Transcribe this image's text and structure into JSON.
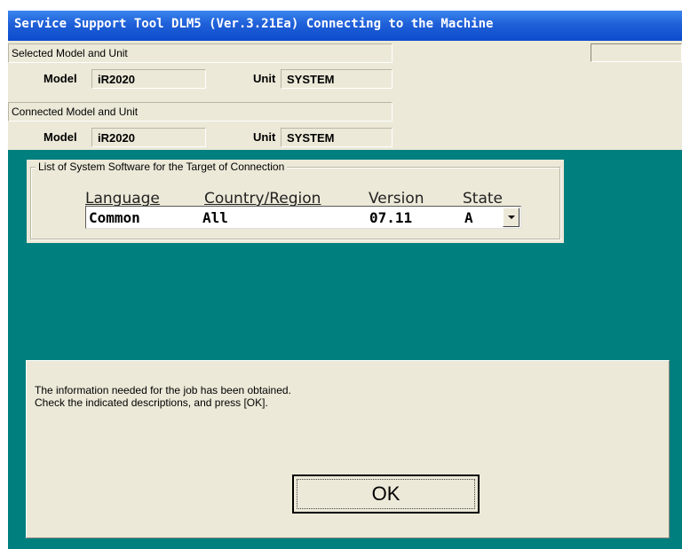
{
  "window": {
    "title": "Service Support Tool DLM5 (Ver.3.21Ea) Connecting to the Machine"
  },
  "selected": {
    "section_label": "Selected Model and Unit",
    "model_label": "Model",
    "model_value": "iR2020",
    "unit_label": "Unit",
    "unit_value": "SYSTEM"
  },
  "connected": {
    "section_label": "Connected Model and Unit",
    "model_label": "Model",
    "model_value": "iR2020",
    "unit_label": "Unit",
    "unit_value": "SYSTEM"
  },
  "software_list": {
    "group_title": "List of System Software for the Target of Connection",
    "columns": {
      "language": "Language",
      "country": "Country/Region",
      "version": "Version",
      "state": "State"
    },
    "row": {
      "language": "Common",
      "country": "All",
      "version": "07.11",
      "state": "A"
    }
  },
  "message": {
    "line1": "The information needed for the job has been obtained.",
    "line2": "Check the indicated descriptions, and press [OK]."
  },
  "buttons": {
    "ok_label": "OK"
  },
  "colors": {
    "titlebar": "#0d4ccc",
    "background_teal": "#007f7f",
    "panel": "#ece9d8"
  }
}
